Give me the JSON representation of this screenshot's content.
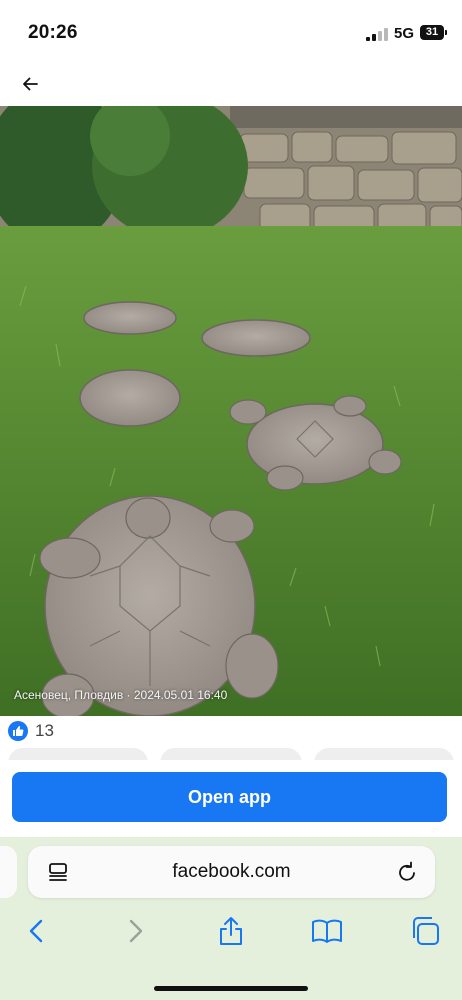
{
  "status_bar": {
    "time": "20:26",
    "network": "5G",
    "battery": "31"
  },
  "post": {
    "caption": "Асеновец, Пловдив · 2024.05.01 16:40",
    "like_count": "13"
  },
  "open_app": {
    "label": "Open app"
  },
  "browser": {
    "url": "facebook.com"
  },
  "colors": {
    "brand": "#1877f2",
    "safari_bar": "#e4efdc"
  },
  "icons": [
    "back-arrow-icon",
    "like-icon",
    "reader-icon",
    "reload-icon",
    "back-icon",
    "forward-icon",
    "share-icon",
    "bookmarks-icon",
    "tabs-icon"
  ]
}
